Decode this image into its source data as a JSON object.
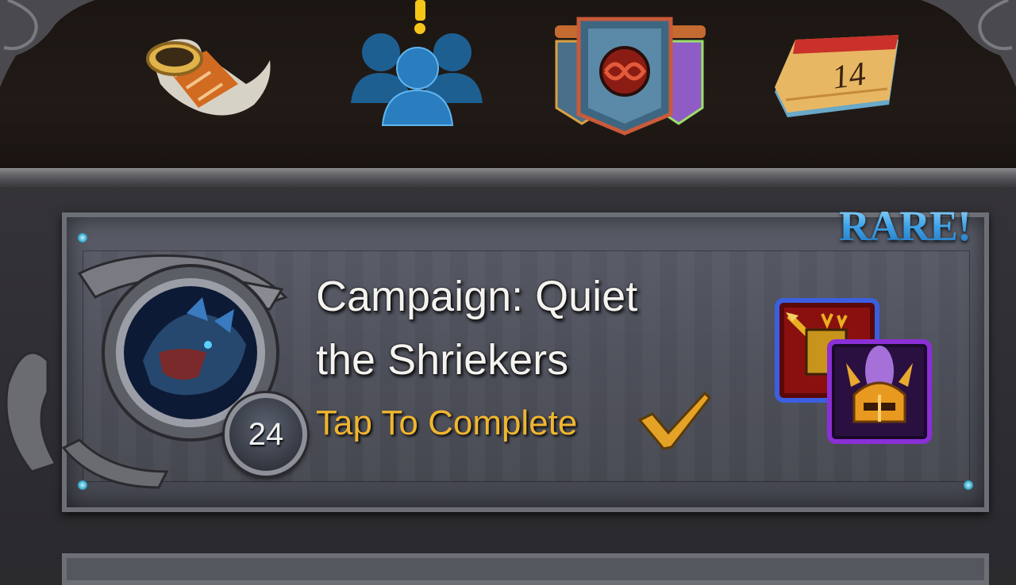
{
  "nav": {
    "items": [
      {
        "name": "horn",
        "icon": "horn-icon"
      },
      {
        "name": "social",
        "icon": "group-icon",
        "alert": "!"
      },
      {
        "name": "guild",
        "icon": "guild-banner-icon"
      },
      {
        "name": "calendar",
        "icon": "calendar-icon",
        "day": "14"
      }
    ]
  },
  "quest": {
    "rarity": "RARE!",
    "title_line1": "Campaign: Quiet",
    "title_line2": "the Shriekers",
    "action": "Tap To Complete",
    "level": "24",
    "portrait_icon": "dragon-portrait-icon",
    "rewards": [
      {
        "icon": "spear-banner-reward-icon",
        "rarity_color": "#3b5fe0"
      },
      {
        "icon": "golden-helm-reward-icon",
        "rarity_color": "#8b2fd6"
      }
    ]
  },
  "colors": {
    "rare_text": "#4fb4f0",
    "action_text": "#f0b530",
    "title_text": "#f5f3ef"
  }
}
